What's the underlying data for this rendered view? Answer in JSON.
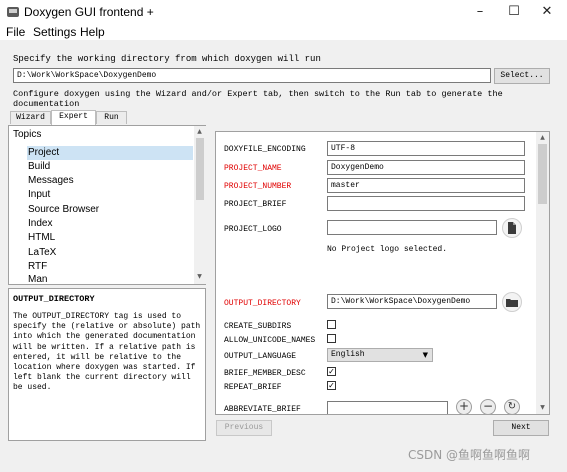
{
  "window": {
    "title": "Doxygen GUI frontend +",
    "minimize": "–",
    "maximize": "☐",
    "close": "✕"
  },
  "menu": {
    "file": "File",
    "settings": "Settings",
    "help": "Help"
  },
  "workdir": {
    "prompt": "Specify the working directory from which doxygen will run",
    "value": "D:\\Work\\WorkSpace\\DoxygenDemo",
    "select_label": "Select..."
  },
  "instruction": "Configure doxygen using the Wizard and/or Expert tab, then switch to the Run tab to generate the documentation",
  "tabs": {
    "wizard": "Wizard",
    "expert": "Expert",
    "run": "Run"
  },
  "topics": {
    "header": "Topics",
    "selected": "Project",
    "items": [
      "Project",
      "Build",
      "Messages",
      "Input",
      "Source Browser",
      "Index",
      "HTML",
      "LaTeX",
      "RTF",
      "Man"
    ]
  },
  "help": {
    "title": "OUTPUT_DIRECTORY",
    "text": "The OUTPUT_DIRECTORY tag is used to specify the (relative or absolute) path into which the generated documentation will be written. If a relative path is entered, it will be relative to the location where doxygen was started. If left blank the current directory will be used."
  },
  "settings": {
    "doxyfile_encoding": {
      "label": "DOXYFILE_ENCODING",
      "value": "UTF-8"
    },
    "project_name": {
      "label": "PROJECT_NAME",
      "value": "DoxygenDemo"
    },
    "project_number": {
      "label": "PROJECT_NUMBER",
      "value": "master"
    },
    "project_brief": {
      "label": "PROJECT_BRIEF",
      "value": ""
    },
    "project_logo": {
      "label": "PROJECT_LOGO",
      "value": "",
      "status": "No Project logo selected."
    },
    "output_directory": {
      "label": "OUTPUT_DIRECTORY",
      "value": "D:\\Work\\WorkSpace\\DoxygenDemo"
    },
    "create_subdirs": {
      "label": "CREATE_SUBDIRS",
      "checked": false
    },
    "allow_unicode_names": {
      "label": "ALLOW_UNICODE_NAMES",
      "checked": false
    },
    "output_language": {
      "label": "OUTPUT_LANGUAGE",
      "value": "English"
    },
    "brief_member_desc": {
      "label": "BRIEF_MEMBER_DESC",
      "checked": true
    },
    "repeat_brief": {
      "label": "REPEAT_BRIEF",
      "checked": true
    },
    "abbreviate_brief": {
      "label": "ABBREVIATE_BRIEF",
      "value": ""
    }
  },
  "nav": {
    "previous": "Previous",
    "next": "Next"
  },
  "watermark": "CSDN @鱼啊鱼啊鱼啊",
  "colors": {
    "modified_label": "#e00000",
    "selection": "#cde3f4"
  }
}
